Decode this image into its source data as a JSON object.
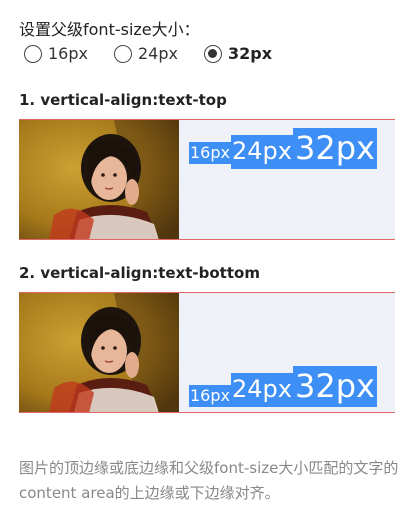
{
  "setting": {
    "label": "设置父级font-size大小："
  },
  "radios": [
    {
      "label": "16px",
      "checked": false
    },
    {
      "label": "24px",
      "checked": false
    },
    {
      "label": "32px",
      "checked": true
    }
  ],
  "section1": {
    "title": "1. vertical-align:text-top",
    "chips": [
      "16px",
      "24px",
      "32px"
    ]
  },
  "section2": {
    "title": "2. vertical-align:text-bottom",
    "chips": [
      "16px",
      "24px",
      "32px"
    ]
  },
  "note": "图片的顶边缘或底边缘和父级font-size大小匹配的文字的content area的上边缘或下边缘对齐。",
  "colors": {
    "chip": "#3d8ef5",
    "boundary": "#e06666",
    "demo_bg": "#eef1f8"
  }
}
